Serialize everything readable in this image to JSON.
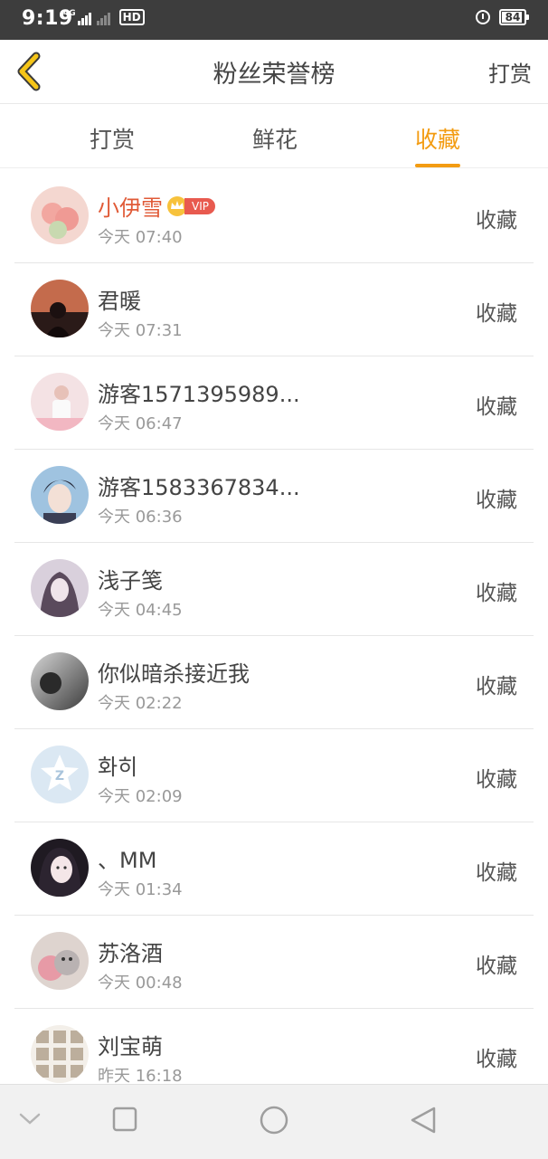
{
  "status_bar": {
    "time": "9:19",
    "network": "4G",
    "hd_label": "HD",
    "battery": "84"
  },
  "header": {
    "title": "粉丝荣誉榜",
    "right_action": "打赏",
    "back_icon": "chevron-left-icon"
  },
  "tabs": [
    {
      "label": "打赏",
      "active": false
    },
    {
      "label": "鲜花",
      "active": false
    },
    {
      "label": "收藏",
      "active": true
    }
  ],
  "accent_color": "#f39c12",
  "vip_badge": "VIP",
  "items": [
    {
      "name": "小伊雪",
      "time": "今天 07:40",
      "action": "收藏",
      "vip": true
    },
    {
      "name": "君暖",
      "time": "今天 07:31",
      "action": "收藏"
    },
    {
      "name": "游客1571395989...",
      "time": "今天 06:47",
      "action": "收藏"
    },
    {
      "name": "游客1583367834...",
      "time": "今天 06:36",
      "action": "收藏"
    },
    {
      "name": "浅子笺",
      "time": "今天 04:45",
      "action": "收藏"
    },
    {
      "name": "你似暗杀接近我",
      "time": "今天 02:22",
      "action": "收藏"
    },
    {
      "name": "화히",
      "time": "今天 02:09",
      "action": "收藏"
    },
    {
      "name": "、MM",
      "time": "今天 01:34",
      "action": "收藏"
    },
    {
      "name": "苏洛酒",
      "time": "今天 00:48",
      "action": "收藏"
    },
    {
      "name": "刘宝萌",
      "time": "昨天 16:18",
      "action": "收藏"
    }
  ],
  "nav_bar": [
    "chevron-down-icon",
    "square-icon",
    "circle-icon",
    "triangle-back-icon"
  ]
}
